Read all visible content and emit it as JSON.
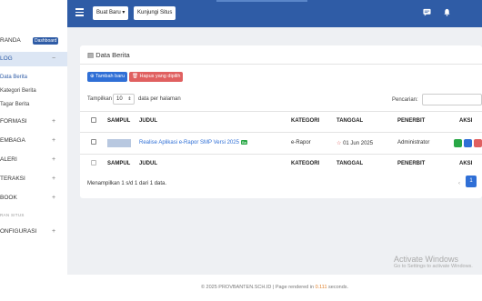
{
  "topbar": {
    "new_button": "Buat Baru",
    "visit_button": "Kunjungi Situs"
  },
  "sidebar": {
    "beranda": "RANDA",
    "beranda_badge": "Dashboard",
    "blog": "LOG",
    "blog_sign": "−",
    "sub_items": [
      "Data Berita",
      "Kategori Berita",
      "Tagar Berita"
    ],
    "items": [
      {
        "label": "FORMASI",
        "sign": "+"
      },
      {
        "label": "EMBAGA",
        "sign": "+"
      },
      {
        "label": "ALERI",
        "sign": "+"
      },
      {
        "label": "TERAKSI",
        "sign": "+"
      },
      {
        "label": "BOOK",
        "sign": "+"
      }
    ],
    "caption": "RAN SITUS",
    "konfigurasi": "ONFIGURASI",
    "konfigurasi_sign": "+"
  },
  "card": {
    "title": "Data Berita",
    "add_button": "Tambah baru",
    "delete_button": "Hapus yang dipilih",
    "show_prefix": "Tampilkan",
    "show_value": "10",
    "show_suffix": "data per halaman",
    "search_label": "Pencarian:"
  },
  "table": {
    "headers": [
      "SAMPUL",
      "JUDUL",
      "KATEGORI",
      "TANGGAL",
      "PENERBIT",
      "AKSI"
    ],
    "row": {
      "title": "Realise Aplikasi e-Rapor SMP Versi 2025",
      "badge": "Ba",
      "category": "e-Rapor",
      "date": "01 Jun 2025",
      "publisher": "Administrator"
    },
    "info": "Menampilkan 1 s/d 1 dari 1 data.",
    "prev": "‹",
    "page": "1"
  },
  "footer": {
    "prefix": "© 2025 PROVBANTEN.SCH.ID | Page rendered in",
    "time": "0.111",
    "suffix": "seconds."
  },
  "watermark": {
    "line1": "Activate Windows",
    "line2": "Go to Settings to activate Windows."
  },
  "colors": {
    "topbar": "#2f5ca6",
    "primary": "#2f6fd6",
    "danger": "#e06060"
  }
}
